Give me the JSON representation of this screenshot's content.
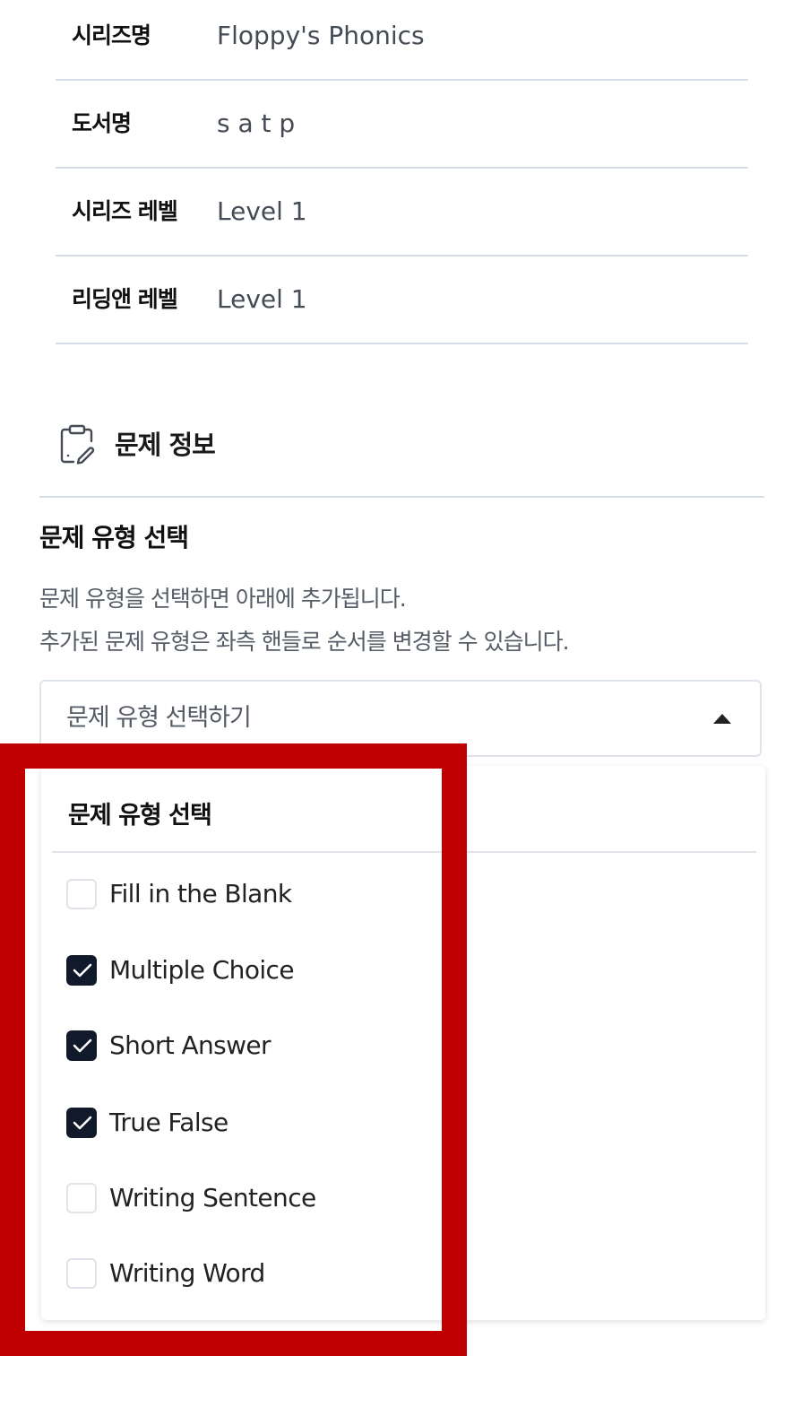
{
  "book_info": {
    "rows": [
      {
        "label": "시리즈명",
        "value": "Floppy's Phonics"
      },
      {
        "label": "도서명",
        "value": "s a t p"
      },
      {
        "label": "시리즈 레벨",
        "value": "Level 1"
      },
      {
        "label": "리딩앤 레벨",
        "value": "Level 1"
      }
    ]
  },
  "question_section": {
    "icon": "clipboard-edit-icon",
    "title": "문제 정보",
    "subtitle": "문제 유형 선택",
    "description_line1": "문제 유형을 선택하면 아래에 추가됩니다.",
    "description_line2": "추가된 문제 유형은 좌측 핸들로 순서를 변경할 수 있습니다."
  },
  "select": {
    "value": "문제 유형 선택하기",
    "arrow_icon": "caret-up-icon"
  },
  "dropdown": {
    "header": "문제 유형 선택",
    "options": [
      {
        "label": "Fill in the Blank",
        "checked": false
      },
      {
        "label": "Multiple Choice",
        "checked": true
      },
      {
        "label": "Short Answer",
        "checked": true
      },
      {
        "label": "True False",
        "checked": true
      },
      {
        "label": "Writing Sentence",
        "checked": false
      },
      {
        "label": "Writing Word",
        "checked": false
      }
    ]
  },
  "colors": {
    "highlight": "#c00000",
    "checkbox_checked": "#101a2a",
    "divider": "#d5dde6"
  }
}
